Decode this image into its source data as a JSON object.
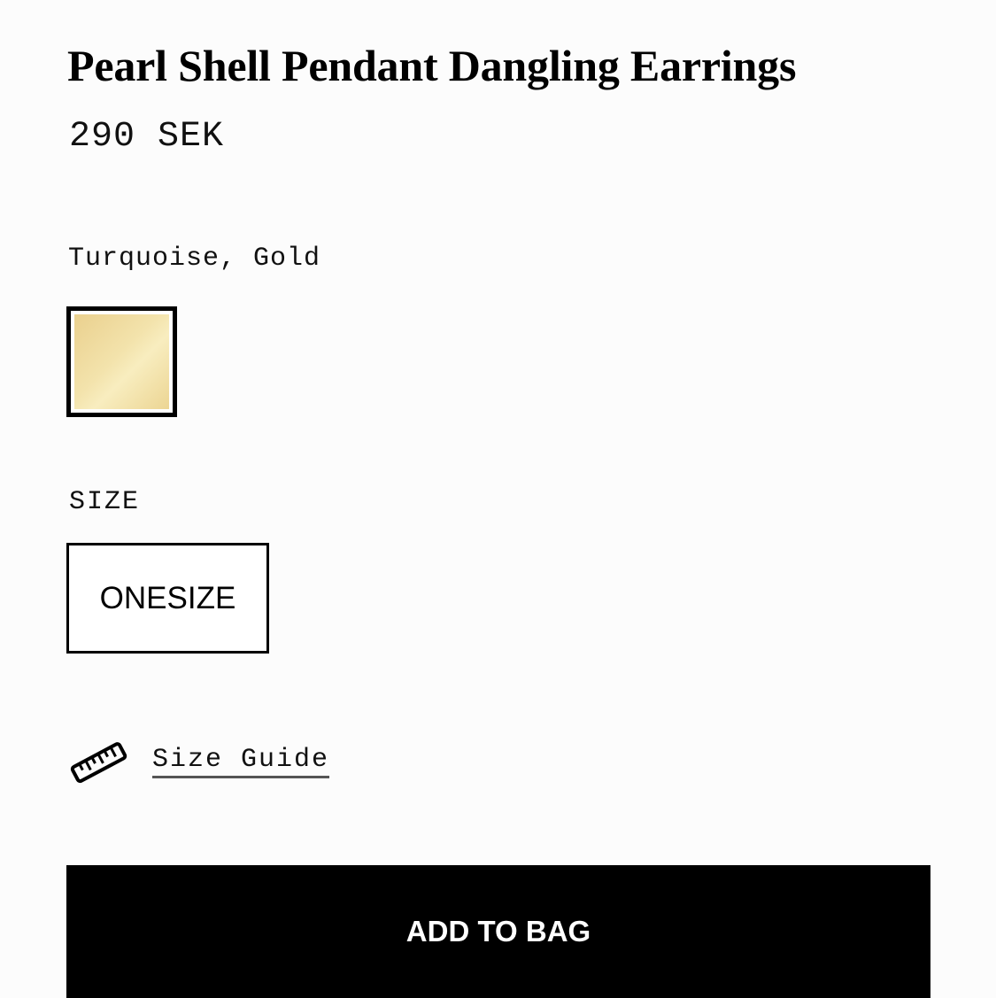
{
  "product": {
    "title": "Pearl Shell Pendant Dangling Earrings",
    "price": "290 SEK",
    "color_name": "Turquoise, Gold"
  },
  "swatch": {
    "selected": true,
    "colors": [
      "#ead08e",
      "#f8edbf"
    ]
  },
  "size": {
    "label": "SIZE",
    "options": [
      "ONESIZE"
    ]
  },
  "size_guide": {
    "label": "Size Guide",
    "icon": "ruler-icon"
  },
  "cta": {
    "label": "ADD TO BAG",
    "background": "#000000",
    "color": "#ffffff"
  }
}
